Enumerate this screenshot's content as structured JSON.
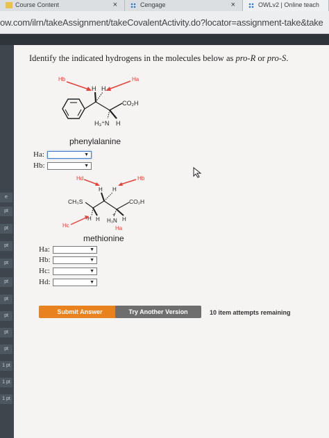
{
  "browser": {
    "tabs": [
      {
        "label": "Course Content",
        "close": "×"
      },
      {
        "label": "Cengage",
        "close": "×"
      },
      {
        "label": "OWLv2 | Online teach"
      }
    ],
    "url": "ow.com/ilrn/takeAssignment/takeCovalentActivity.do?locator=assignment-take&take"
  },
  "sidebar": {
    "items": [
      "e",
      "pt",
      "pt",
      "pt",
      "pt",
      "pt",
      "pt",
      "pt",
      "pt",
      "pt",
      "1 pt",
      "1 pt",
      "1 pt"
    ]
  },
  "question": {
    "prefix": "Identify the indicated hydrogens in the molecules below as ",
    "term1": "pro-R",
    "mid": " or ",
    "term2": "pro-S",
    "suffix": "."
  },
  "phenylalanine": {
    "name": "phenylalanine",
    "labels": {
      "hb": "Hb",
      "ha": "Ha",
      "h1": "H",
      "h2": "H",
      "co2h": "CO₂H",
      "h3n": "H₃⁺N",
      "hbot": "H"
    },
    "selects": [
      {
        "label": "Ha:",
        "value": ""
      },
      {
        "label": "Hb:",
        "value": ""
      }
    ]
  },
  "methionine": {
    "name": "methionine",
    "labels": {
      "hd": "Hd",
      "hb": "Hb",
      "h1": "H",
      "h2": "H",
      "ch3s": "CH₃S",
      "co2h": "CO₂H",
      "h3": "H",
      "h4": "H",
      "h5": "H",
      "h3n": "H₃N",
      "plus": "+",
      "hc": "Hc",
      "ha": "Ha"
    },
    "selects": [
      {
        "label": "Ha:",
        "value": ""
      },
      {
        "label": "Hb:",
        "value": ""
      },
      {
        "label": "Hc:",
        "value": ""
      },
      {
        "label": "Hd:",
        "value": ""
      }
    ]
  },
  "actions": {
    "submit": "Submit Answer",
    "try_another": "Try Another Version",
    "attempts": "10 item attempts remaining"
  },
  "colors": {
    "accent": "#e8821e",
    "arrow": "#e8413a",
    "button_gray": "#6e6e6e"
  }
}
